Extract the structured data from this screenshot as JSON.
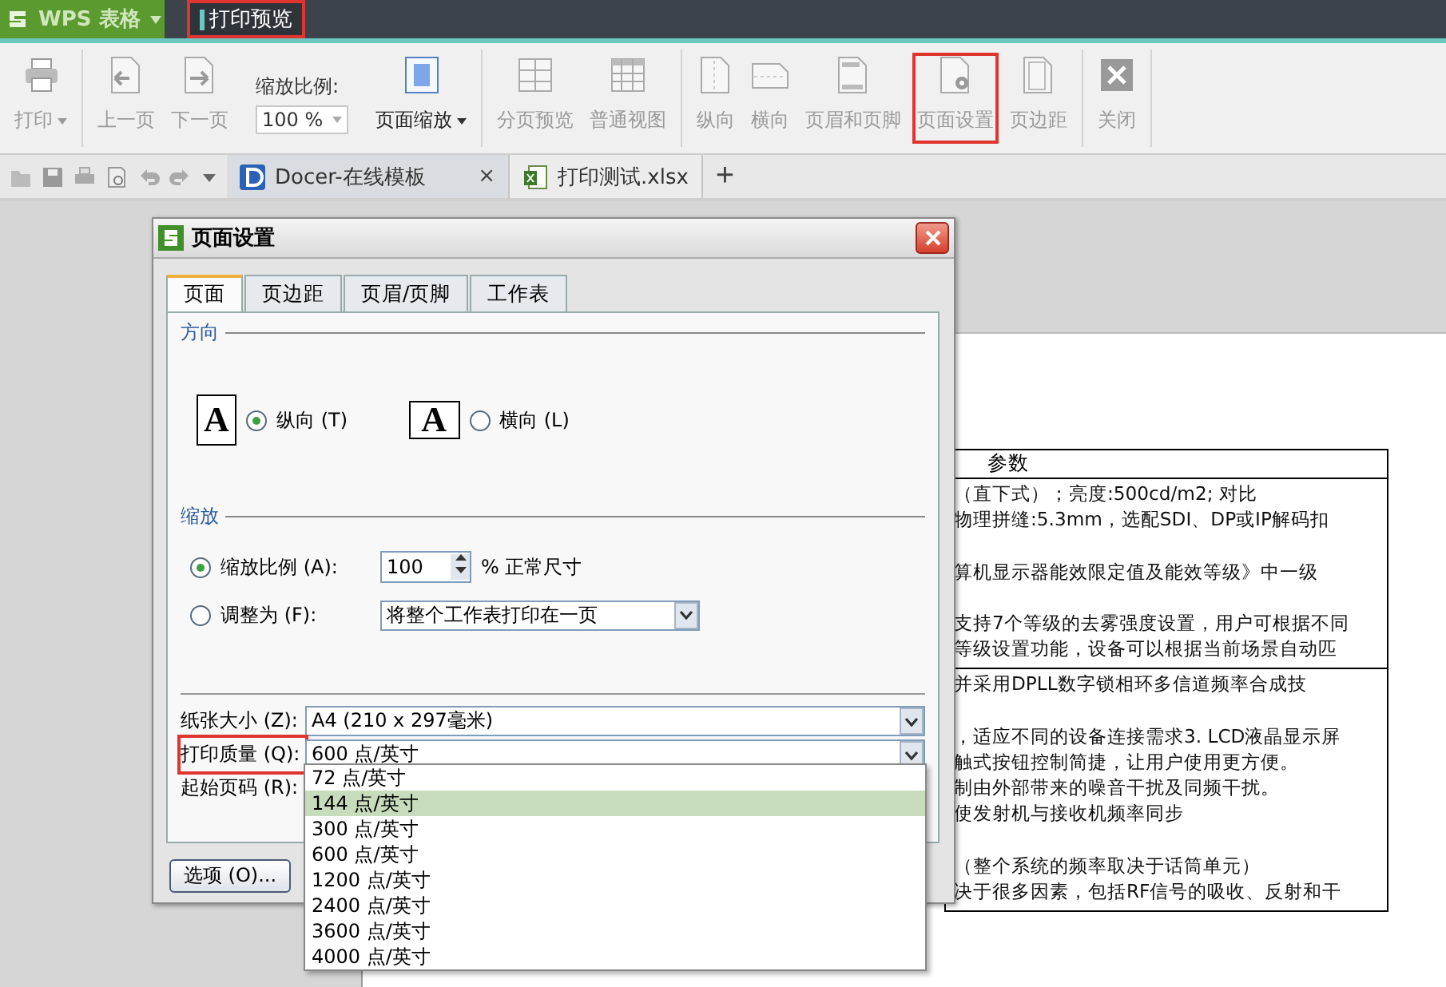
{
  "title_bar": {
    "app_menu": "WPS 表格",
    "tab": {
      "label": "打印预览",
      "highlighted": true
    }
  },
  "toolbar": {
    "groups": [
      {
        "items": [
          {
            "kind": "button",
            "label": "打印",
            "caret": true,
            "disabled": true,
            "highlighted": false
          }
        ]
      },
      {
        "items": [
          {
            "kind": "button",
            "label": "上一页",
            "caret": false,
            "disabled": true,
            "highlighted": false
          },
          {
            "kind": "button",
            "label": "下一页",
            "caret": false,
            "disabled": true,
            "highlighted": false
          },
          {
            "kind": "zoom",
            "label": "缩放比例:",
            "value": "100 %"
          },
          {
            "kind": "button",
            "label": "页面缩放",
            "caret": true,
            "disabled": false,
            "highlighted": false
          }
        ]
      },
      {
        "items": [
          {
            "kind": "button",
            "label": "分页预览",
            "caret": false,
            "disabled": true,
            "highlighted": false
          },
          {
            "kind": "button",
            "label": "普通视图",
            "caret": false,
            "disabled": true,
            "highlighted": false
          }
        ]
      },
      {
        "items": [
          {
            "kind": "button",
            "label": "纵向",
            "caret": false,
            "disabled": true,
            "highlighted": false
          },
          {
            "kind": "button",
            "label": "横向",
            "caret": false,
            "disabled": true,
            "highlighted": false
          },
          {
            "kind": "button",
            "label": "页眉和页脚",
            "caret": false,
            "disabled": true,
            "highlighted": false
          },
          {
            "kind": "button",
            "label": "页面设置",
            "caret": false,
            "disabled": true,
            "highlighted": true
          },
          {
            "kind": "button",
            "label": "页边距",
            "caret": false,
            "disabled": true,
            "highlighted": false
          }
        ]
      },
      {
        "items": [
          {
            "kind": "button",
            "label": "关闭",
            "caret": false,
            "disabled": true,
            "highlighted": false
          }
        ]
      }
    ]
  },
  "doc_tabs": [
    {
      "label": "Docer-在线模板",
      "selected": false,
      "close": "×"
    },
    {
      "label": "打印测试.xlsx",
      "selected": true
    }
  ],
  "new_tab": "+",
  "document": {
    "table": {
      "header": "参数",
      "rows": [
        [
          "（直下式）；亮度:500cd/m2; 对比",
          "物理拼缝:5.3mm，选配SDI、DP或IP解码扣",
          "",
          "算机显示器能效限定值及能效等级》中一级",
          "",
          "支持7个等级的去雾强度设置，用户可根据不同",
          "等级设置功能，设备可以根据当前场景自动匹"
        ],
        [
          "并采用DPLL数字锁相环多信道频率合成技",
          "",
          "，适应不同的设备连接需求3. LCD液晶显示屏",
          "触式按钮控制简捷，让用户使用更方便。",
          "制由外部带来的噪音干扰及同频干扰。",
          "使发射机与接收机频率同步",
          "",
          "（整个系统的频率取决于话筒单元）",
          "决于很多因素，包括RF信号的吸收、反射和干"
        ]
      ]
    }
  },
  "dialog": {
    "title": "页面设置",
    "tabs": [
      {
        "label": "页面",
        "selected": true
      },
      {
        "label": "页边距",
        "selected": false
      },
      {
        "label": "页眉/页脚",
        "selected": false
      },
      {
        "label": "工作表",
        "selected": false
      }
    ],
    "orientation": {
      "heading": "方向",
      "options": [
        {
          "kind": "portrait",
          "icon_letter": "A",
          "label": "纵向 (T)",
          "selected": true
        },
        {
          "kind": "landscape",
          "icon_letter": "A",
          "label": "横向 (L)",
          "selected": false
        }
      ]
    },
    "scaling": {
      "heading": "缩放",
      "options": [
        {
          "kind": "percent",
          "label": "缩放比例 (A):",
          "value": "100",
          "suffix": "% 正常尺寸",
          "selected": true
        },
        {
          "kind": "fit",
          "label": "调整为 (F):",
          "value": "将整个工作表打印在一页",
          "selected": false
        }
      ]
    },
    "fields": [
      {
        "kind": "select",
        "label": "纸张大小 (Z):",
        "value": "A4 (210 x 297毫米)",
        "highlighted": false
      },
      {
        "kind": "select",
        "label": "打印质量 (Q):",
        "value": "600 点/英寸",
        "highlighted": true
      },
      {
        "kind": "hidden",
        "label": "起始页码 (R):",
        "highlighted": false
      }
    ],
    "options_button": "选项 (O)..."
  },
  "quality_dropdown": [
    {
      "label": "72 点/英寸",
      "selected": false
    },
    {
      "label": "144 点/英寸",
      "selected": true
    },
    {
      "label": "300 点/英寸",
      "selected": false
    },
    {
      "label": "600 点/英寸",
      "selected": false
    },
    {
      "label": "1200 点/英寸",
      "selected": false
    },
    {
      "label": "2400 点/英寸",
      "selected": false
    },
    {
      "label": "3600 点/英寸",
      "selected": false
    },
    {
      "label": "4000 点/英寸",
      "selected": false
    }
  ]
}
